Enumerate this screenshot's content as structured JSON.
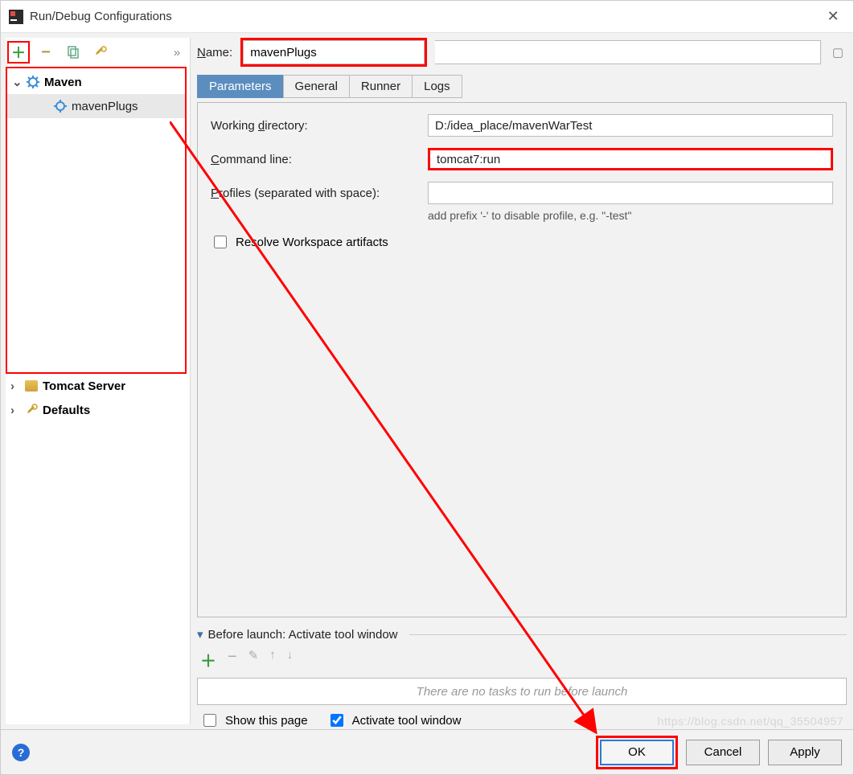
{
  "titlebar": {
    "title": "Run/Debug Configurations"
  },
  "sidebar": {
    "toolbar": {
      "add": "+",
      "remove": "−"
    },
    "maven": {
      "label": "Maven",
      "child": "mavenPlugs"
    },
    "tomcat": {
      "label": "Tomcat Server"
    },
    "defaults": {
      "label": "Defaults"
    }
  },
  "form": {
    "name_label": "Name:",
    "name_value": "mavenPlugs",
    "tabs": {
      "parameters": "Parameters",
      "general": "General",
      "runner": "Runner",
      "logs": "Logs"
    },
    "working_dir_label": "Working directory:",
    "working_dir_value": "D:/idea_place/mavenWarTest",
    "command_line_label": "Command line:",
    "command_line_value": "tomcat7:run",
    "profiles_label": "Profiles (separated with space):",
    "profiles_value": "",
    "profiles_hint": "add prefix '-' to disable profile, e.g. \"-test\"",
    "resolve_label": "Resolve Workspace artifacts"
  },
  "before_launch": {
    "header": "Before launch: Activate tool window",
    "empty": "There are no tasks to run before launch",
    "show_page": "Show this page",
    "activate": "Activate tool window"
  },
  "footer": {
    "ok": "OK",
    "cancel": "Cancel",
    "apply": "Apply"
  },
  "watermark": "https://blog.csdn.net/qq_35504957"
}
